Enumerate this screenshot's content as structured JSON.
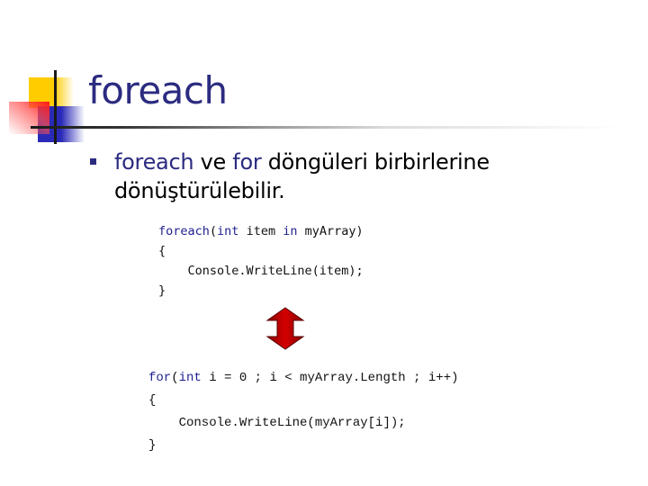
{
  "slide": {
    "title": "foreach",
    "bullets": [
      {
        "parts": [
          {
            "text": "foreach",
            "highlight": true
          },
          {
            "text": " ve ",
            "highlight": false
          },
          {
            "text": "for",
            "highlight": true
          },
          {
            "text": " döngüleri birbirlerine dönüştürülebilir.",
            "highlight": false
          }
        ]
      }
    ],
    "code_foreach": {
      "line1": {
        "kw1": "foreach",
        "p1": "(",
        "kw2": "int",
        "p2": " item ",
        "kw3": "in",
        "p3": " myArray)"
      },
      "line2": "{",
      "line3": "    Console.WriteLine(item);",
      "line4": "}"
    },
    "code_for": {
      "line1": {
        "kw1": "for",
        "p1": "(",
        "kw2": "int",
        "p2": " i = 0 ; i < myArray.Length ; i++)"
      },
      "line2": "{",
      "line3": "    Console.WriteLine(myArray[i]);",
      "line4": "}"
    },
    "arrow": {
      "icon": "double-arrow-vertical-icon",
      "color": "#c00000"
    },
    "colors": {
      "title": "#2b2b80",
      "keyword": "#1f1f8f",
      "bullet": "#2b2b80",
      "logo_yellow": "#ffcc00",
      "logo_blue": "#2a2ab8",
      "logo_red": "#ff1a1a"
    }
  }
}
